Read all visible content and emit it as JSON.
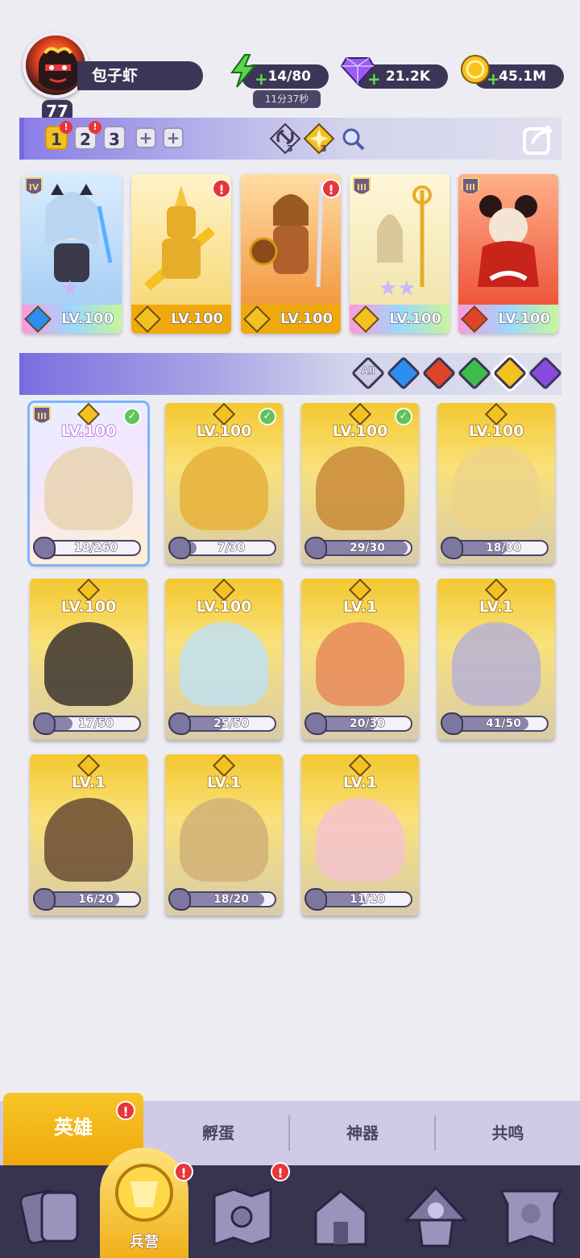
{
  "player": {
    "level": "77",
    "name": "包子虾"
  },
  "resources": {
    "energy": {
      "value": "14/80",
      "timer": "11分37秒",
      "icon": "lightning-icon"
    },
    "gems": {
      "value": "21.2K",
      "icon": "gem-icon"
    },
    "gold": {
      "value": "45.1M",
      "icon": "coin-icon"
    }
  },
  "team_bar": {
    "teams": [
      "1",
      "2",
      "3"
    ],
    "active_team": "1",
    "plus": "+",
    "counters": [
      "3",
      "3"
    ]
  },
  "squad": [
    {
      "lv": "LV.100",
      "rank": "IV",
      "element": "water",
      "color": "#b3d6ff"
    },
    {
      "lv": "LV.100",
      "rank": "",
      "element": "light",
      "color": "#f5c542",
      "alert": "!"
    },
    {
      "lv": "LV.100",
      "rank": "",
      "element": "light",
      "color": "#f08a2c",
      "alert": "!"
    },
    {
      "lv": "LV.100",
      "rank": "III",
      "element": "light",
      "color": "#efe1a6"
    },
    {
      "lv": "LV.100",
      "rank": "III",
      "element": "fire",
      "color": "#e9412a"
    }
  ],
  "filters": {
    "all_label": "All",
    "elements": [
      {
        "name": "water",
        "color": "#2b8ef0"
      },
      {
        "name": "fire",
        "color": "#e0432a"
      },
      {
        "name": "wind",
        "color": "#3bbf4a"
      },
      {
        "name": "light",
        "color": "#f3c221"
      },
      {
        "name": "dark",
        "color": "#8a4ae0"
      }
    ]
  },
  "heroes": [
    {
      "lv": "LV.100",
      "progress": "18/260",
      "ratio": 0.07,
      "owned": true,
      "rank": "III",
      "tint": "#e8d3b0"
    },
    {
      "lv": "LV.100",
      "progress": "7/30",
      "ratio": 0.23,
      "owned": true,
      "tint": "#e7b23a"
    },
    {
      "lv": "LV.100",
      "progress": "29/30",
      "ratio": 0.97,
      "owned": true,
      "tint": "#c98a3a"
    },
    {
      "lv": "LV.100",
      "progress": "18/30",
      "ratio": 0.6,
      "owned": false,
      "tint": "#efd48a"
    },
    {
      "lv": "LV.100",
      "progress": "17/50",
      "ratio": 0.34,
      "owned": false,
      "tint": "#3c3430"
    },
    {
      "lv": "LV.100",
      "progress": "25/50",
      "ratio": 0.5,
      "owned": false,
      "tint": "#bfe1f2"
    },
    {
      "lv": "LV.1",
      "progress": "20/30",
      "ratio": 0.67,
      "owned": false,
      "tint": "#e88a5a"
    },
    {
      "lv": "LV.1",
      "progress": "41/50",
      "ratio": 0.82,
      "owned": false,
      "tint": "#b7b2d6"
    },
    {
      "lv": "LV.1",
      "progress": "16/20",
      "ratio": 0.8,
      "owned": false,
      "tint": "#6a4a32"
    },
    {
      "lv": "LV.1",
      "progress": "18/20",
      "ratio": 0.9,
      "owned": false,
      "tint": "#d2b277"
    },
    {
      "lv": "LV.1",
      "progress": "11/20",
      "ratio": 0.55,
      "owned": false,
      "tint": "#f3c3cf"
    }
  ],
  "sub_tabs": [
    {
      "label": "英雄",
      "active": true,
      "alert": "!"
    },
    {
      "label": "孵蛋"
    },
    {
      "label": "神器"
    },
    {
      "label": "共鸣"
    }
  ],
  "nav": [
    {
      "icon": "cards-icon"
    },
    {
      "icon": "barracks-icon",
      "label": "兵营",
      "active": true,
      "alert": "!"
    },
    {
      "icon": "map-icon",
      "alert": "!"
    },
    {
      "icon": "building-icon"
    },
    {
      "icon": "mushroom-shrine-icon"
    },
    {
      "icon": "guild-banner-icon"
    }
  ]
}
